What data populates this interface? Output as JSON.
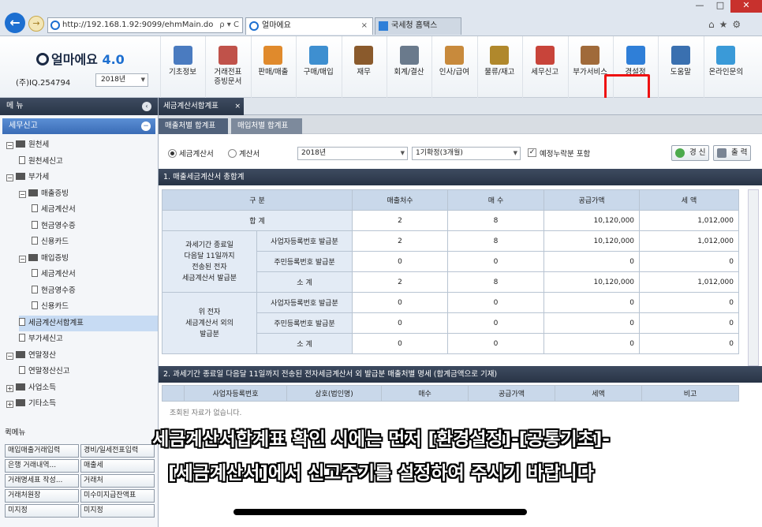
{
  "browser": {
    "address": "http://192.168.1.92:9099/ehmMain.do",
    "address_tools": "ρ ▾ C",
    "tabs": [
      {
        "label": "얼마에요",
        "close": "×"
      },
      {
        "label": "국세청 홈택스"
      }
    ],
    "window_controls": {
      "minimize": "—",
      "maximize": "□",
      "close": "✕"
    },
    "corner_icons": "⌂★⚙"
  },
  "app": {
    "logo_text": "얼마에요",
    "logo_version": "4.0",
    "company": "(주)IQ.254794",
    "year": "2018년",
    "toolbar": [
      {
        "label": "기초정보",
        "icon": "basic-info-icon",
        "color": "#4a7bc0"
      },
      {
        "label": "거래전표\n증빙문서",
        "icon": "voucher-icon",
        "color": "#c0524a"
      },
      {
        "label": "판매/매출",
        "icon": "sales-icon",
        "color": "#e08a2c"
      },
      {
        "label": "구매/매입",
        "icon": "purchase-icon",
        "color": "#3e8fd0"
      },
      {
        "label": "재무",
        "icon": "finance-icon",
        "color": "#8a5a2c"
      },
      {
        "label": "회계/결산",
        "icon": "accounting-icon",
        "color": "#6a7a8c"
      },
      {
        "label": "인사/급여",
        "icon": "hr-icon",
        "color": "#c88a3c"
      },
      {
        "label": "물류/재고",
        "icon": "logistics-icon",
        "color": "#b0882c"
      },
      {
        "label": "세무신고",
        "icon": "tax-icon",
        "color": "#c8443a"
      },
      {
        "label": "부가서비스",
        "icon": "service-icon",
        "color": "#a06a3a"
      },
      {
        "label": "경설정",
        "icon": "settings-icon",
        "color": "#2f7fd8"
      },
      {
        "label": "도움말",
        "icon": "help-icon",
        "color": "#3a70b0"
      },
      {
        "label": "온라인문의",
        "icon": "online-inquiry-icon",
        "color": "#3a9ad8"
      }
    ]
  },
  "sidebar": {
    "title": "메 뉴",
    "collapse": "‹",
    "section": "세무신고",
    "section_toggle": "−",
    "tree": [
      {
        "label": "원천세",
        "level": 0,
        "type": "folder",
        "toggle": "−"
      },
      {
        "label": "원천세신고",
        "level": 1,
        "type": "page"
      },
      {
        "label": "부가세",
        "level": 0,
        "type": "folder",
        "toggle": "−"
      },
      {
        "label": "매출증빙",
        "level": 1,
        "type": "folder",
        "toggle": "−"
      },
      {
        "label": "세금계산서",
        "level": 2,
        "type": "page"
      },
      {
        "label": "현금영수증",
        "level": 2,
        "type": "page"
      },
      {
        "label": "신용카드",
        "level": 2,
        "type": "page"
      },
      {
        "label": "매입증빙",
        "level": 1,
        "type": "folder",
        "toggle": "−"
      },
      {
        "label": "세금계산서",
        "level": 2,
        "type": "page"
      },
      {
        "label": "현금영수증",
        "level": 2,
        "type": "page"
      },
      {
        "label": "신용카드",
        "level": 2,
        "type": "page"
      },
      {
        "label": "세금계산서합계표",
        "level": 1,
        "type": "page",
        "selected": true
      },
      {
        "label": "부가세신고",
        "level": 1,
        "type": "page"
      },
      {
        "label": "연말정산",
        "level": 0,
        "type": "folder",
        "toggle": "−"
      },
      {
        "label": "연말정산신고",
        "level": 1,
        "type": "page"
      },
      {
        "label": "사업소득",
        "level": 0,
        "type": "folder",
        "toggle": "+"
      },
      {
        "label": "기타소득",
        "level": 0,
        "type": "folder",
        "toggle": "+"
      }
    ],
    "quick_title": "퀵메뉴",
    "quick": [
      "매입매출거래입력",
      "경비/일세전표입력",
      "은행 거래내역...",
      "매출세",
      "거래명세표 작성...",
      "거래처",
      "거래처원장",
      "미수미지급잔액표",
      "미지정",
      "미지정"
    ]
  },
  "main": {
    "tab": "세금계산서합계표",
    "tab_close": "×",
    "subtabs": [
      "매출처별 합계표",
      "매입처별 합계표"
    ],
    "filter": {
      "radio1": "세금계산서",
      "radio2": "계산서",
      "year": "2018년",
      "period": "1기확정(3개월)",
      "checkbox": "예정누락분 포함",
      "check_mark": "✓",
      "refresh": "경 신",
      "print": "출 력"
    },
    "section1": "1. 매출세금계산서 총합계",
    "summary": {
      "headers": [
        "구 분",
        "매출처수",
        "매 수",
        "공급가액",
        "세 액"
      ],
      "total_label": "합 계",
      "total": [
        "2",
        "8",
        "10,120,000",
        "1,012,000"
      ],
      "group1_label": "과세기간 종료일\n다음달 11일까지\n전송된 전자\n세금계산서 발급분",
      "group1": [
        {
          "label": "사업자등록번호 발급분",
          "values": [
            "2",
            "8",
            "10,120,000",
            "1,012,000"
          ]
        },
        {
          "label": "주민등록번호 발급분",
          "values": [
            "0",
            "0",
            "0",
            "0"
          ]
        },
        {
          "label": "소 계",
          "values": [
            "2",
            "8",
            "10,120,000",
            "1,012,000"
          ]
        }
      ],
      "group2_label": "위 전자\n세금계산서 외의\n발급분",
      "group2": [
        {
          "label": "사업자등록번호 발급분",
          "values": [
            "0",
            "0",
            "0",
            "0"
          ]
        },
        {
          "label": "주민등록번호 발급분",
          "values": [
            "0",
            "0",
            "0",
            "0"
          ]
        },
        {
          "label": "소 계",
          "values": [
            "0",
            "0",
            "0",
            "0"
          ]
        }
      ]
    },
    "section2": "2. 과세기간 종료일 다음달 11일까지 전송된 전자세금계산서 외 발급분 매출처별 명세 (합계금액으로 기재)",
    "detail_headers": [
      "",
      "사업자등록번호",
      "상호(법인명)",
      "매수",
      "공급가액",
      "세액",
      "비고"
    ],
    "empty_text": "조회된 자료가 없습니다."
  },
  "captions": {
    "line1": "세금계산서합계표 확인 시에는 먼저 [환경설정]-[공통기초]-",
    "line2": "[세금계산서]에서 신고주기를 설정하여 주시기 바랍니다"
  }
}
